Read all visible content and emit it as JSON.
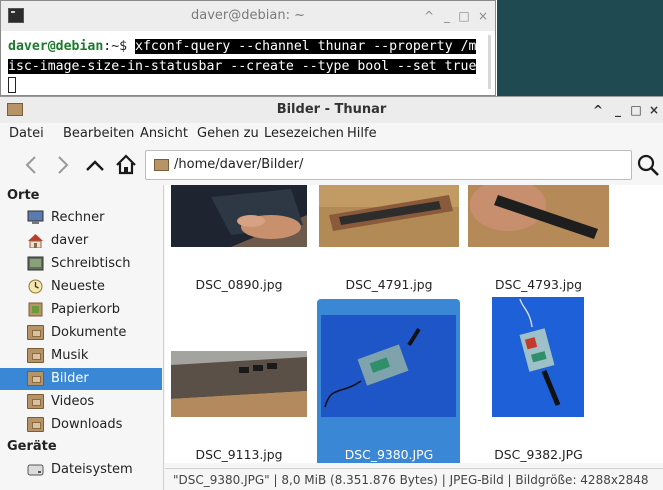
{
  "terminal": {
    "title": "daver@debian: ~",
    "prompt_user": "daver@debian",
    "prompt_rest": ":~$ ",
    "command_line1": "xfconf-query --channel thunar --property /m",
    "command_line2": "isc-image-size-in-statusbar --create --type bool --set true",
    "controls": {
      "minimize": "^",
      "iconify": "_",
      "maximize": "□",
      "close": "×"
    }
  },
  "thunar": {
    "title": "Bilder - Thunar",
    "controls": {
      "minimize": "^",
      "iconify": "_",
      "maximize": "□",
      "close": "×"
    },
    "menu": [
      "Datei",
      "Bearbeiten",
      "Ansicht",
      "Gehen zu",
      "Lesezeichen",
      "Hilfe"
    ],
    "location": "/home/daver/Bilder/",
    "sidebar": {
      "places_heading": "Orte",
      "places": [
        {
          "label": "Rechner",
          "icon": "computer-icon"
        },
        {
          "label": "daver",
          "icon": "home-icon"
        },
        {
          "label": "Schreibtisch",
          "icon": "desktop-icon"
        },
        {
          "label": "Neueste",
          "icon": "recent-icon"
        },
        {
          "label": "Papierkorb",
          "icon": "trash-icon"
        },
        {
          "label": "Dokumente",
          "icon": "folder-icon"
        },
        {
          "label": "Musik",
          "icon": "folder-icon"
        },
        {
          "label": "Bilder",
          "icon": "folder-icon",
          "selected": true
        },
        {
          "label": "Videos",
          "icon": "folder-icon"
        },
        {
          "label": "Downloads",
          "icon": "folder-icon"
        }
      ],
      "devices_heading": "Geräte",
      "devices": [
        {
          "label": "Dateisystem",
          "icon": "drive-icon"
        }
      ]
    },
    "files": [
      {
        "name": "DSC_0890.jpg",
        "selected": false
      },
      {
        "name": "DSC_4791.jpg",
        "selected": false
      },
      {
        "name": "DSC_4793.jpg",
        "selected": false
      },
      {
        "name": "DSC_9113.jpg",
        "selected": false
      },
      {
        "name": "DSC_9380.JPG",
        "selected": true
      },
      {
        "name": "DSC_9382.JPG",
        "selected": false
      }
    ],
    "status": "\"DSC_9380.JPG\" | 8,0 MiB (8.351.876 Bytes) | JPEG-Bild | Bildgröße: 4288x2848"
  },
  "colors": {
    "selection": "#3a87d6",
    "desktop": "#1f4a52",
    "prompt": "#1c7a2a"
  }
}
